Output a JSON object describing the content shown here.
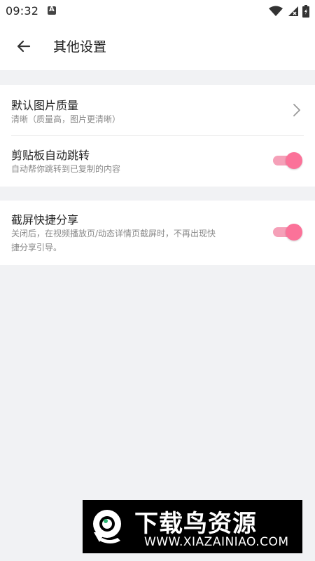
{
  "status_bar": {
    "time": "09:32",
    "icons": [
      "a-notification-icon",
      "wifi-icon",
      "signal-icon",
      "battery-icon"
    ]
  },
  "header": {
    "title": "其他设置",
    "back_icon": "arrow-left-icon"
  },
  "settings": {
    "image_quality": {
      "title": "默认图片质量",
      "subtitle": "清晰（质量高，图片更清晰）"
    },
    "clipboard_jump": {
      "title": "剪贴板自动跳转",
      "subtitle": "自动帮你跳转到已复制的内容",
      "enabled": true
    },
    "screenshot_share": {
      "title": "截屏快捷分享",
      "subtitle_line1": "关闭后，在视频播放页/动态详情页截屏时，不再出现快",
      "subtitle_line2": "捷分享引导。",
      "enabled": true
    }
  },
  "colors": {
    "accent": "#fb7299",
    "accent_track": "#f5a0b8",
    "background": "#f1f2f4",
    "card": "#ffffff"
  },
  "watermark": {
    "title": "下载鸟资源",
    "url": "WWW.XIAZAINIAO.COM"
  }
}
